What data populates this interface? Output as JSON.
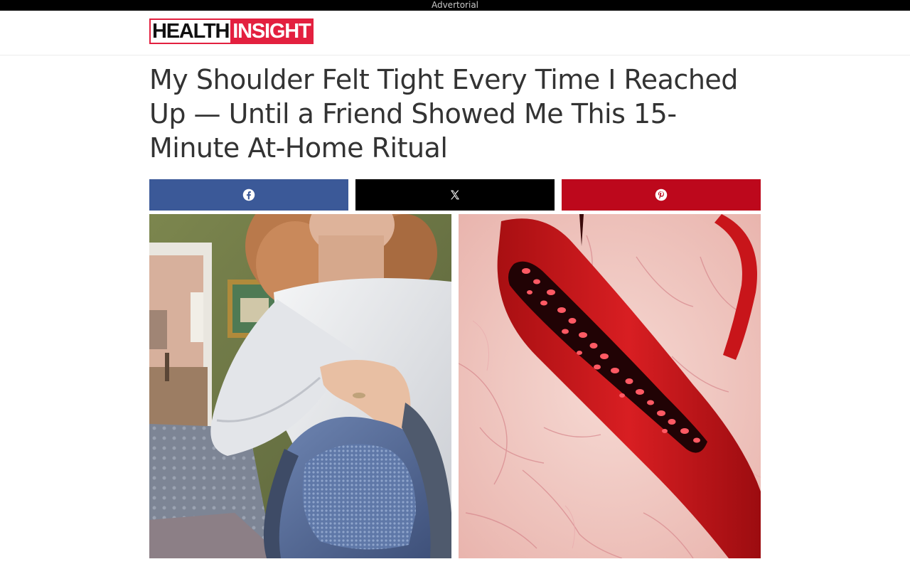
{
  "ad_bar": {
    "label": "Advertorial"
  },
  "header": {
    "logo_part1": "HEALTH",
    "logo_part2": "INSIGHT"
  },
  "article": {
    "headline": "My Shoulder Felt Tight Every Time I Reached Up — Until a Friend Showed Me This 15-Minute At-Home Ritual"
  },
  "share": {
    "buttons": [
      {
        "network": "facebook",
        "icon": "facebook-icon",
        "color": "#3b5998"
      },
      {
        "network": "x",
        "icon": "x-icon",
        "color": "#000000"
      },
      {
        "network": "pinterest",
        "icon": "pinterest-icon",
        "color": "#bd081c"
      }
    ]
  },
  "images": {
    "left": {
      "subject": "woman-wearing-shoulder-brace"
    },
    "right": {
      "subject": "blood-vessel-illustration"
    }
  },
  "colors": {
    "brand_red": "#e3203f",
    "headline_text": "#333333"
  }
}
